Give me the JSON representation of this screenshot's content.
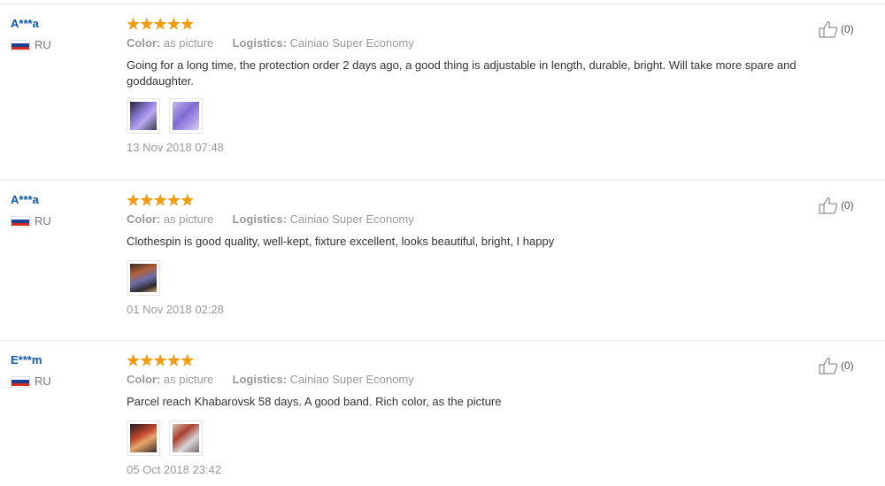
{
  "reviews": [
    {
      "user": "A***a",
      "country": "RU",
      "rating": 5,
      "color_label": "Color:",
      "color_value": "as picture",
      "logistics_label": "Logistics:",
      "logistics_value": "Cainiao Super Economy",
      "text": "Going for a long time, the protection order 2 days ago, a good thing is adjustable in length, durable, bright. Will take more spare and goddaughter.",
      "photos": 2,
      "date": "13 Nov 2018 07:48",
      "likes": "(0)"
    },
    {
      "user": "A***a",
      "country": "RU",
      "rating": 5,
      "color_label": "Color:",
      "color_value": "as picture",
      "logistics_label": "Logistics:",
      "logistics_value": "Cainiao Super Economy",
      "text": "Clothespin is good quality, well-kept, fixture excellent, looks beautiful, bright, I happy",
      "photos": 1,
      "date": "01 Nov 2018 02:28",
      "likes": "(0)"
    },
    {
      "user": "E***m",
      "country": "RU",
      "rating": 5,
      "color_label": "Color:",
      "color_value": "as picture",
      "logistics_label": "Logistics:",
      "logistics_value": "Cainiao Super Economy",
      "text": "Parcel reach Khabarovsk 58 days. A good band. Rich color, as the picture",
      "photos": 2,
      "date": "05 Oct 2018 23:42",
      "likes": "(0)"
    }
  ],
  "colors": {
    "star": "#f39c12",
    "username": "#0a58b0",
    "flag_white": "#ffffff",
    "flag_blue": "#1c3f94",
    "flag_red": "#d52b1e"
  },
  "icons": {
    "like": "thumbs-up-icon"
  }
}
